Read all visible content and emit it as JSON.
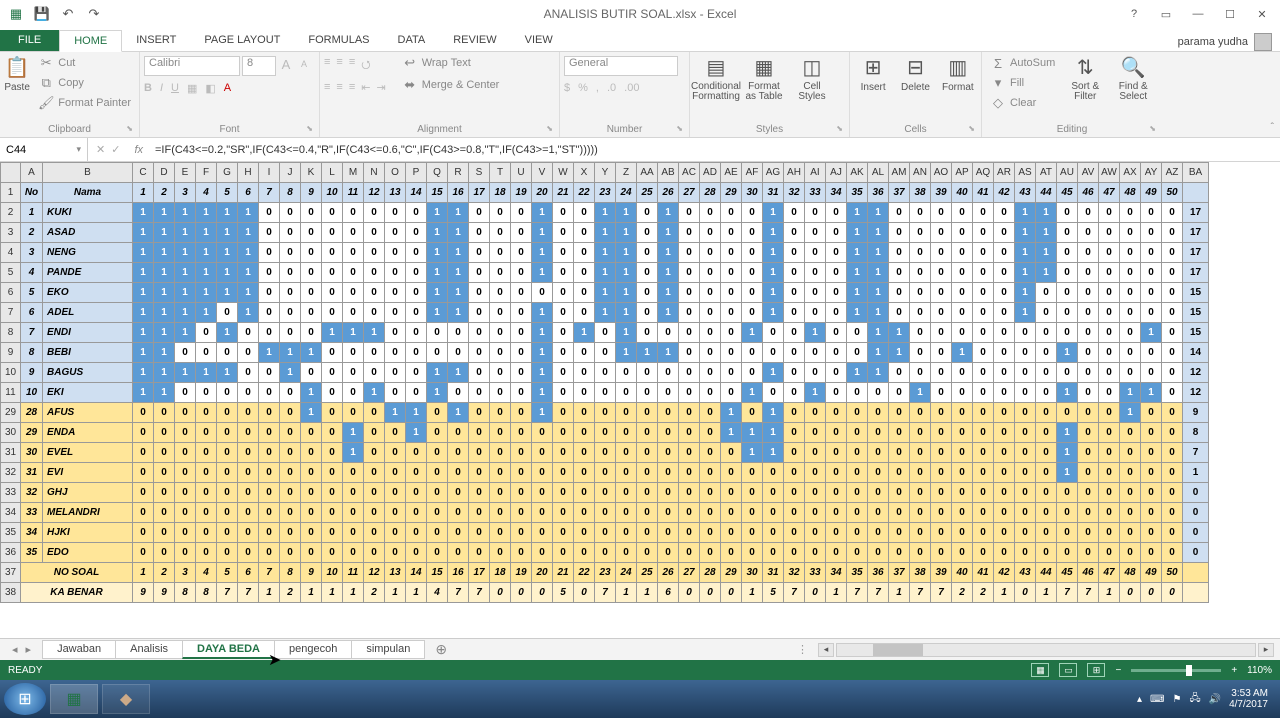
{
  "app": {
    "title": "ANALISIS BUTIR SOAL.xlsx - Excel",
    "account": "parama yudha"
  },
  "tabs": [
    "FILE",
    "HOME",
    "INSERT",
    "PAGE LAYOUT",
    "FORMULAS",
    "DATA",
    "REVIEW",
    "VIEW"
  ],
  "ribbon": {
    "clipboard": {
      "paste": "Paste",
      "cut": "Cut",
      "copy": "Copy",
      "painter": "Format Painter",
      "label": "Clipboard"
    },
    "font": {
      "name": "Calibri",
      "size": "8",
      "label": "Font"
    },
    "alignment": {
      "wrap": "Wrap Text",
      "merge": "Merge & Center",
      "label": "Alignment"
    },
    "number": {
      "format": "General",
      "label": "Number"
    },
    "styles": {
      "cond": "Conditional Formatting",
      "table": "Format as Table",
      "cell": "Cell Styles",
      "label": "Styles"
    },
    "cells": {
      "insert": "Insert",
      "delete": "Delete",
      "format": "Format",
      "label": "Cells"
    },
    "editing": {
      "sum": "AutoSum",
      "fill": "Fill",
      "clear": "Clear",
      "sort": "Sort & Filter",
      "find": "Find & Select",
      "label": "Editing"
    }
  },
  "namebox": "C44",
  "formula": "=IF(C43<=0.2,\"SR\",IF(C43<=0.4,\"R\",IF(C43<=0.6,\"C\",IF(C43>=0.8,\"T\",IF(C43>=1,\"ST\")))))",
  "col_letters": [
    "A",
    "B",
    "C",
    "D",
    "E",
    "F",
    "G",
    "H",
    "I",
    "J",
    "K",
    "L",
    "M",
    "N",
    "O",
    "P",
    "Q",
    "R",
    "S",
    "T",
    "U",
    "V",
    "W",
    "X",
    "Y",
    "Z",
    "AA",
    "AB",
    "AC",
    "AD",
    "AE",
    "AF",
    "AG",
    "AH",
    "AI",
    "AJ",
    "AK",
    "AL",
    "AM",
    "AN",
    "AO",
    "AP",
    "AQ",
    "AR",
    "AS",
    "AT",
    "AU",
    "AV",
    "AW",
    "AX",
    "AY",
    "AZ",
    "BA"
  ],
  "q_headers": [
    "1",
    "2",
    "3",
    "4",
    "5",
    "6",
    "7",
    "8",
    "9",
    "10",
    "11",
    "12",
    "13",
    "14",
    "15",
    "16",
    "17",
    "18",
    "19",
    "20",
    "21",
    "22",
    "23",
    "24",
    "25",
    "26",
    "27",
    "28",
    "29",
    "30",
    "31",
    "32",
    "33",
    "34",
    "35",
    "36",
    "37",
    "38",
    "39",
    "40",
    "41",
    "42",
    "43",
    "44",
    "45",
    "46",
    "47",
    "48",
    "49",
    "50"
  ],
  "header_no": "No",
  "header_nama": "Nama",
  "rows_top": [
    {
      "r": 2,
      "no": "1",
      "nama": "KUKI",
      "v": [
        1,
        1,
        1,
        1,
        1,
        1,
        0,
        0,
        0,
        0,
        0,
        0,
        0,
        0,
        1,
        1,
        0,
        0,
        0,
        1,
        0,
        0,
        1,
        1,
        0,
        1,
        0,
        0,
        0,
        0,
        1,
        0,
        0,
        0,
        1,
        1,
        0,
        0,
        0,
        0,
        0,
        0,
        1,
        1,
        0,
        0,
        0,
        0,
        0,
        0
      ],
      "s": 17
    },
    {
      "r": 3,
      "no": "2",
      "nama": "ASAD",
      "v": [
        1,
        1,
        1,
        1,
        1,
        1,
        0,
        0,
        0,
        0,
        0,
        0,
        0,
        0,
        1,
        1,
        0,
        0,
        0,
        1,
        0,
        0,
        1,
        1,
        0,
        1,
        0,
        0,
        0,
        0,
        1,
        0,
        0,
        0,
        1,
        1,
        0,
        0,
        0,
        0,
        0,
        0,
        1,
        1,
        0,
        0,
        0,
        0,
        0,
        0
      ],
      "s": 17
    },
    {
      "r": 4,
      "no": "3",
      "nama": "NENG",
      "v": [
        1,
        1,
        1,
        1,
        1,
        1,
        0,
        0,
        0,
        0,
        0,
        0,
        0,
        0,
        1,
        1,
        0,
        0,
        0,
        1,
        0,
        0,
        1,
        1,
        0,
        1,
        0,
        0,
        0,
        0,
        1,
        0,
        0,
        0,
        1,
        1,
        0,
        0,
        0,
        0,
        0,
        0,
        1,
        1,
        0,
        0,
        0,
        0,
        0,
        0
      ],
      "s": 17
    },
    {
      "r": 5,
      "no": "4",
      "nama": "PANDE",
      "v": [
        1,
        1,
        1,
        1,
        1,
        1,
        0,
        0,
        0,
        0,
        0,
        0,
        0,
        0,
        1,
        1,
        0,
        0,
        0,
        1,
        0,
        0,
        1,
        1,
        0,
        1,
        0,
        0,
        0,
        0,
        1,
        0,
        0,
        0,
        1,
        1,
        0,
        0,
        0,
        0,
        0,
        0,
        1,
        1,
        0,
        0,
        0,
        0,
        0,
        0
      ],
      "s": 17
    },
    {
      "r": 6,
      "no": "5",
      "nama": "EKO",
      "v": [
        1,
        1,
        1,
        1,
        1,
        1,
        0,
        0,
        0,
        0,
        0,
        0,
        0,
        0,
        1,
        1,
        0,
        0,
        0,
        0,
        0,
        0,
        1,
        1,
        0,
        1,
        0,
        0,
        0,
        0,
        1,
        0,
        0,
        0,
        1,
        1,
        0,
        0,
        0,
        0,
        0,
        0,
        1,
        0,
        0,
        0,
        0,
        0,
        0,
        0
      ],
      "s": 15
    },
    {
      "r": 7,
      "no": "6",
      "nama": "ADEL",
      "v": [
        1,
        1,
        1,
        1,
        0,
        1,
        0,
        0,
        0,
        0,
        0,
        0,
        0,
        0,
        1,
        1,
        0,
        0,
        0,
        1,
        0,
        0,
        1,
        1,
        0,
        1,
        0,
        0,
        0,
        0,
        1,
        0,
        0,
        0,
        1,
        1,
        0,
        0,
        0,
        0,
        0,
        0,
        1,
        0,
        0,
        0,
        0,
        0,
        0,
        0
      ],
      "s": 15
    },
    {
      "r": 8,
      "no": "7",
      "nama": "ENDI",
      "v": [
        1,
        1,
        1,
        0,
        1,
        0,
        0,
        0,
        0,
        1,
        1,
        1,
        0,
        0,
        0,
        0,
        0,
        0,
        0,
        1,
        0,
        1,
        0,
        1,
        0,
        0,
        0,
        0,
        0,
        1,
        0,
        0,
        1,
        0,
        0,
        1,
        1,
        0,
        0,
        0,
        0,
        0,
        0,
        0,
        0,
        0,
        0,
        0,
        1,
        0
      ],
      "s": 15
    },
    {
      "r": 9,
      "no": "8",
      "nama": "BEBI",
      "v": [
        1,
        1,
        0,
        0,
        0,
        0,
        1,
        1,
        1,
        0,
        0,
        0,
        0,
        0,
        0,
        0,
        0,
        0,
        0,
        1,
        0,
        0,
        0,
        1,
        1,
        1,
        0,
        0,
        0,
        0,
        0,
        0,
        0,
        0,
        0,
        1,
        1,
        0,
        0,
        1,
        0,
        0,
        0,
        0,
        1,
        0,
        0,
        0,
        0,
        0
      ],
      "s": 14
    },
    {
      "r": 10,
      "no": "9",
      "nama": "BAGUS",
      "v": [
        1,
        1,
        1,
        1,
        1,
        0,
        0,
        1,
        0,
        0,
        0,
        0,
        0,
        0,
        1,
        1,
        0,
        0,
        0,
        1,
        0,
        0,
        0,
        0,
        0,
        0,
        0,
        0,
        0,
        0,
        1,
        0,
        0,
        0,
        1,
        1,
        0,
        0,
        0,
        0,
        0,
        0,
        0,
        0,
        0,
        0,
        0,
        0,
        0,
        0
      ],
      "s": 12
    },
    {
      "r": 11,
      "no": "10",
      "nama": "EKI",
      "v": [
        1,
        1,
        0,
        0,
        0,
        0,
        0,
        0,
        1,
        0,
        0,
        1,
        0,
        0,
        1,
        0,
        0,
        0,
        0,
        1,
        0,
        0,
        0,
        0,
        0,
        0,
        0,
        0,
        0,
        1,
        0,
        0,
        1,
        0,
        0,
        0,
        0,
        1,
        0,
        0,
        0,
        0,
        0,
        0,
        1,
        0,
        0,
        1,
        1,
        0
      ],
      "s": 12
    }
  ],
  "rows_bot": [
    {
      "r": 29,
      "no": "28",
      "nama": "AFUS",
      "v": [
        0,
        0,
        0,
        0,
        0,
        0,
        0,
        0,
        1,
        0,
        0,
        0,
        1,
        1,
        0,
        1,
        0,
        0,
        0,
        1,
        0,
        0,
        0,
        0,
        0,
        0,
        0,
        0,
        1,
        0,
        1,
        0,
        0,
        0,
        0,
        0,
        0,
        0,
        0,
        0,
        0,
        0,
        0,
        0,
        0,
        0,
        0,
        1,
        0,
        0
      ],
      "s": 9
    },
    {
      "r": 30,
      "no": "29",
      "nama": "ENDA",
      "v": [
        0,
        0,
        0,
        0,
        0,
        0,
        0,
        0,
        0,
        0,
        1,
        0,
        0,
        1,
        0,
        0,
        0,
        0,
        0,
        0,
        0,
        0,
        0,
        0,
        0,
        0,
        0,
        0,
        1,
        1,
        1,
        0,
        0,
        0,
        0,
        0,
        0,
        0,
        0,
        0,
        0,
        0,
        0,
        0,
        1,
        0,
        0,
        0,
        0,
        0
      ],
      "s": 8
    },
    {
      "r": 31,
      "no": "30",
      "nama": "EVEL",
      "v": [
        0,
        0,
        0,
        0,
        0,
        0,
        0,
        0,
        0,
        0,
        1,
        0,
        0,
        0,
        0,
        0,
        0,
        0,
        0,
        0,
        0,
        0,
        0,
        0,
        0,
        0,
        0,
        0,
        0,
        1,
        1,
        0,
        0,
        0,
        0,
        0,
        0,
        0,
        0,
        0,
        0,
        0,
        0,
        0,
        1,
        0,
        0,
        0,
        0,
        0
      ],
      "s": 7
    },
    {
      "r": 32,
      "no": "31",
      "nama": "EVI",
      "v": [
        0,
        0,
        0,
        0,
        0,
        0,
        0,
        0,
        0,
        0,
        0,
        0,
        0,
        0,
        0,
        0,
        0,
        0,
        0,
        0,
        0,
        0,
        0,
        0,
        0,
        0,
        0,
        0,
        0,
        0,
        0,
        0,
        0,
        0,
        0,
        0,
        0,
        0,
        0,
        0,
        0,
        0,
        0,
        0,
        1,
        0,
        0,
        0,
        0,
        0
      ],
      "s": 1
    },
    {
      "r": 33,
      "no": "32",
      "nama": "GHJ",
      "v": [
        0,
        0,
        0,
        0,
        0,
        0,
        0,
        0,
        0,
        0,
        0,
        0,
        0,
        0,
        0,
        0,
        0,
        0,
        0,
        0,
        0,
        0,
        0,
        0,
        0,
        0,
        0,
        0,
        0,
        0,
        0,
        0,
        0,
        0,
        0,
        0,
        0,
        0,
        0,
        0,
        0,
        0,
        0,
        0,
        0,
        0,
        0,
        0,
        0,
        0
      ],
      "s": 0
    },
    {
      "r": 34,
      "no": "33",
      "nama": "MELANDRI",
      "v": [
        0,
        0,
        0,
        0,
        0,
        0,
        0,
        0,
        0,
        0,
        0,
        0,
        0,
        0,
        0,
        0,
        0,
        0,
        0,
        0,
        0,
        0,
        0,
        0,
        0,
        0,
        0,
        0,
        0,
        0,
        0,
        0,
        0,
        0,
        0,
        0,
        0,
        0,
        0,
        0,
        0,
        0,
        0,
        0,
        0,
        0,
        0,
        0,
        0,
        0
      ],
      "s": 0
    },
    {
      "r": 35,
      "no": "34",
      "nama": "HJKI",
      "v": [
        0,
        0,
        0,
        0,
        0,
        0,
        0,
        0,
        0,
        0,
        0,
        0,
        0,
        0,
        0,
        0,
        0,
        0,
        0,
        0,
        0,
        0,
        0,
        0,
        0,
        0,
        0,
        0,
        0,
        0,
        0,
        0,
        0,
        0,
        0,
        0,
        0,
        0,
        0,
        0,
        0,
        0,
        0,
        0,
        0,
        0,
        0,
        0,
        0,
        0
      ],
      "s": 0
    },
    {
      "r": 36,
      "no": "35",
      "nama": "EDO",
      "v": [
        0,
        0,
        0,
        0,
        0,
        0,
        0,
        0,
        0,
        0,
        0,
        0,
        0,
        0,
        0,
        0,
        0,
        0,
        0,
        0,
        0,
        0,
        0,
        0,
        0,
        0,
        0,
        0,
        0,
        0,
        0,
        0,
        0,
        0,
        0,
        0,
        0,
        0,
        0,
        0,
        0,
        0,
        0,
        0,
        0,
        0,
        0,
        0,
        0,
        0
      ],
      "s": 0
    }
  ],
  "nosoal": {
    "r": 37,
    "label": "NO SOAL"
  },
  "kabenar": {
    "r": 38,
    "label": "KA BENAR",
    "v": [
      9,
      9,
      8,
      8,
      7,
      7,
      1,
      2,
      1,
      1,
      1,
      2,
      1,
      1,
      4,
      7,
      7,
      0,
      0,
      0,
      5,
      0,
      7,
      1,
      1,
      6,
      0,
      0,
      0,
      1,
      5,
      7,
      0,
      1,
      7,
      7,
      1,
      7,
      7,
      2,
      2,
      1,
      0,
      1,
      7,
      7,
      1,
      0,
      0,
      0
    ]
  },
  "sheet_tabs": [
    "Jawaban",
    "Analisis",
    "DAYA BEDA",
    "pengecoh",
    "simpulan"
  ],
  "active_sheet": 2,
  "status": {
    "ready": "READY",
    "zoom": "110%"
  },
  "tray": {
    "time": "3:53 AM",
    "date": "4/7/2017"
  }
}
